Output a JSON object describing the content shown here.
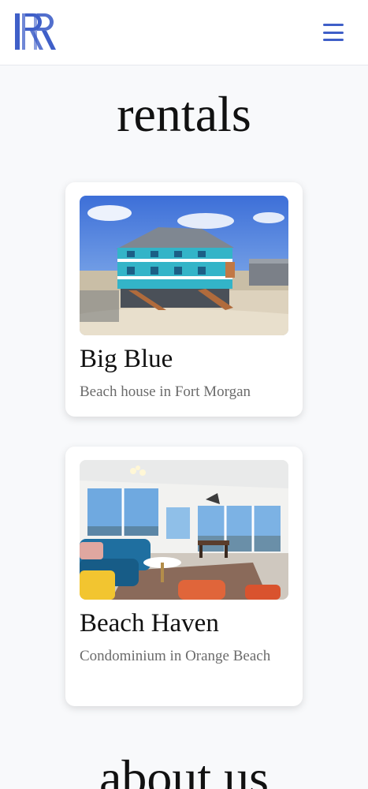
{
  "header": {
    "logo_label": "RR",
    "menu_icon": "hamburger-menu-icon",
    "brand_color": "#3f5fc8"
  },
  "rentals": {
    "title": "rentals",
    "cards": [
      {
        "title": "Big Blue",
        "subtitle": "Beach house in Fort Morgan",
        "image": "beach-house-photo"
      },
      {
        "title": "Beach Haven",
        "subtitle": "Condominium in Orange Beach",
        "image": "condo-living-room-photo"
      }
    ]
  },
  "about": {
    "title": "about us"
  }
}
